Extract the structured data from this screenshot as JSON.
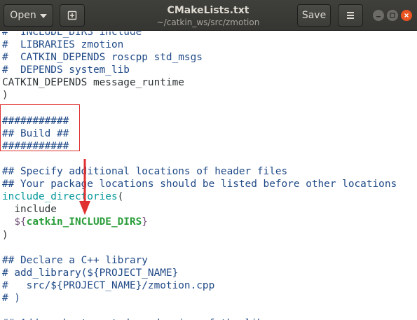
{
  "header": {
    "open_label": "Open",
    "title": "CMakeLists.txt",
    "subtitle": "~/catkin_ws/src/zmotion",
    "save_label": "Save",
    "icons": [
      "new-document-icon",
      "hamburger-menu-icon",
      "minimize-icon",
      "maximize-icon",
      "close-icon"
    ]
  },
  "editor": {
    "lines": [
      {
        "cls": "c-comment",
        "text": "#  INCLUDE_DIRS include"
      },
      {
        "cls": "c-comment",
        "text": "#  LIBRARIES zmotion"
      },
      {
        "cls": "c-comment",
        "text": "#  CATKIN_DEPENDS roscpp std_msgs"
      },
      {
        "cls": "c-comment",
        "text": "#  DEPENDS system_lib"
      },
      {
        "cls": "",
        "text": "CATKIN_DEPENDS message_runtime"
      },
      {
        "cls": "",
        "text": ")"
      },
      {
        "cls": "",
        "text": ""
      },
      {
        "cls": "c-comment",
        "text": "###########"
      },
      {
        "cls": "c-comment",
        "text": "## Build ##"
      },
      {
        "cls": "c-comment",
        "text": "###########"
      },
      {
        "cls": "",
        "text": ""
      },
      {
        "cls": "c-comment",
        "text": "## Specify additional locations of header files"
      },
      {
        "cls": "c-comment",
        "text": "## Your package locations should be listed before other locations"
      },
      {
        "cls": "func",
        "text": "include_directories",
        "rest": "("
      },
      {
        "cls": "",
        "text": "  include"
      },
      {
        "cls": "var",
        "text": "catkin_INCLUDE_DIRS"
      },
      {
        "cls": "",
        "text": ")"
      },
      {
        "cls": "",
        "text": ""
      },
      {
        "cls": "c-comment",
        "text": "## Declare a C++ library"
      },
      {
        "cls": "c-comment",
        "text": "# add_library(${PROJECT_NAME}"
      },
      {
        "cls": "c-comment",
        "text": "#   src/${PROJECT_NAME}/zmotion.cpp"
      },
      {
        "cls": "c-comment",
        "text": "# )"
      },
      {
        "cls": "",
        "text": ""
      },
      {
        "cls": "c-comment",
        "text": "## Add cmake target dependencies of the library"
      }
    ]
  },
  "annotation": {
    "box_color": "#e03030",
    "arrow_color": "#e03030"
  }
}
